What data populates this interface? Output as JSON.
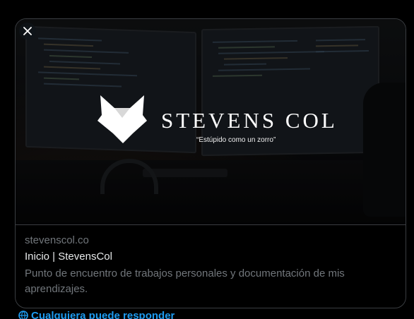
{
  "card": {
    "domain": "stevenscol.co",
    "title": "Inicio | StevensCol",
    "description": "Punto de encuentro de trabajos personales y documentación de mis aprendizajes."
  },
  "hero": {
    "brand": "STEVENS COL",
    "tagline": "“Estúpido como un zorro”"
  },
  "icons": {
    "close": "close-icon",
    "fox": "fox-logo-icon"
  },
  "footer_peek": {
    "icon": "globe-icon",
    "text": "Cualquiera puede responder"
  },
  "colors": {
    "background": "#000000",
    "border": "#3a3d41",
    "muted_text": "#71767b",
    "primary_text": "#e7e9ea",
    "accent": "#1d9bf0"
  }
}
